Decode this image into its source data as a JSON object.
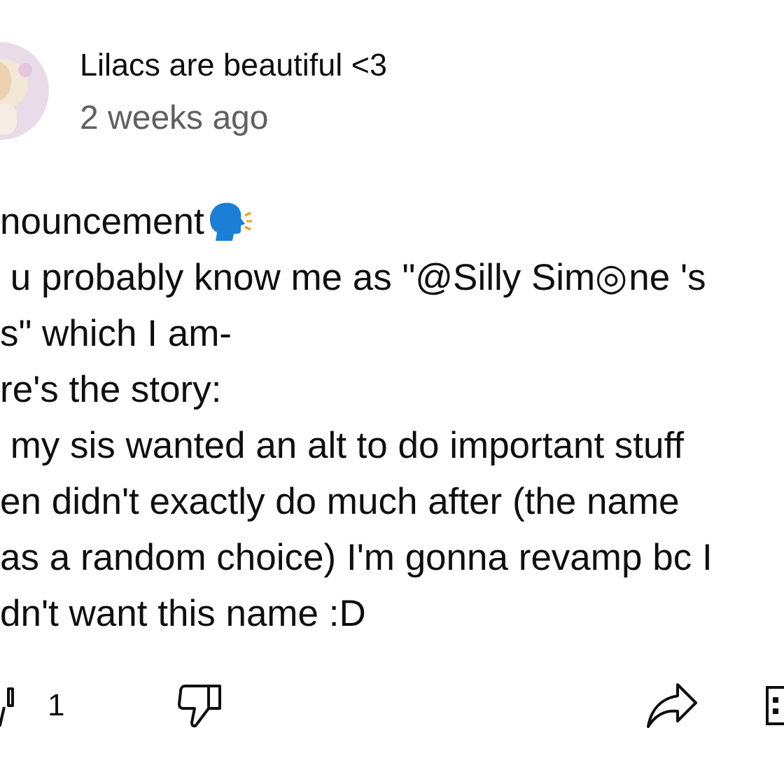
{
  "comment": {
    "author": "Lilacs are beautiful <3",
    "time": "2 weeks ago",
    "lines": [
      {
        "kind": "speaking_head",
        "text": "nouncement"
      },
      {
        "kind": "plain",
        "text": " u probably know me as \"@Silly Sim◎ne 's"
      },
      {
        "kind": "plain",
        "text": "s\" which I am-"
      },
      {
        "kind": "plain",
        "text": "re's the story:"
      },
      {
        "kind": "plain",
        "text": " my sis wanted an alt to do important stuff"
      },
      {
        "kind": "plain",
        "text": "en didn't exactly do much after (the name"
      },
      {
        "kind": "plain",
        "text": "as a random choice) I'm gonna revamp bc I"
      },
      {
        "kind": "plain",
        "text": "dn't want this name :D"
      }
    ],
    "likes": "1"
  }
}
